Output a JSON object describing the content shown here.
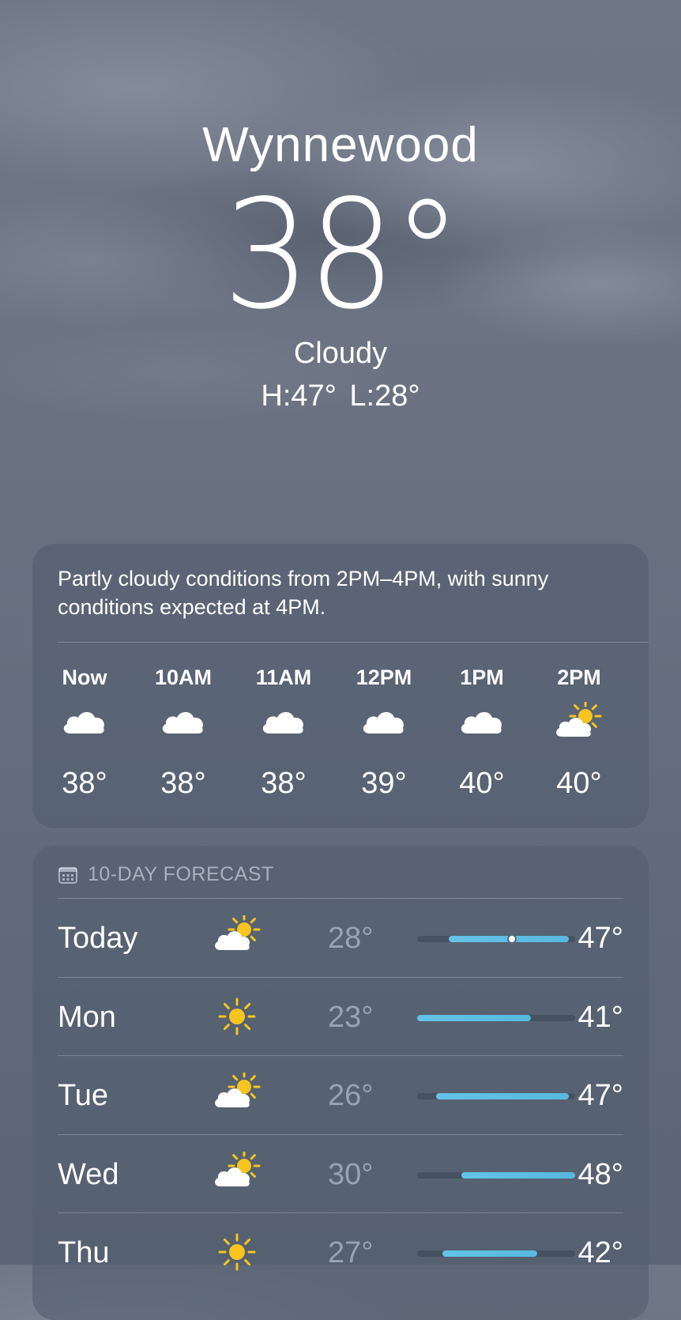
{
  "location": {
    "city": "Wynnewood",
    "temperature": "38°",
    "condition": "Cloudy",
    "high_low": "H:47°  L:28°"
  },
  "hourly": {
    "summary": "Partly cloudy conditions from 2PM–4PM, with sunny conditions expected at 4PM.",
    "hours": [
      {
        "time": "Now",
        "icon": "cloud-icon",
        "temp": "38°"
      },
      {
        "time": "10AM",
        "icon": "cloud-icon",
        "temp": "38°"
      },
      {
        "time": "11AM",
        "icon": "cloud-icon",
        "temp": "38°"
      },
      {
        "time": "12PM",
        "icon": "cloud-icon",
        "temp": "39°"
      },
      {
        "time": "1PM",
        "icon": "cloud-icon",
        "temp": "40°"
      },
      {
        "time": "2PM",
        "icon": "partly-sunny-icon",
        "temp": "40°"
      }
    ]
  },
  "forecast": {
    "title": "10-DAY FORECAST",
    "days": [
      {
        "day": "Today",
        "icon": "partly-sunny-icon",
        "low": "28°",
        "high": "47°",
        "current_marker": true
      },
      {
        "day": "Mon",
        "icon": "sun-icon",
        "low": "23°",
        "high": "41°",
        "current_marker": false
      },
      {
        "day": "Tue",
        "icon": "partly-sunny-icon",
        "low": "26°",
        "high": "47°",
        "current_marker": false
      },
      {
        "day": "Wed",
        "icon": "partly-sunny-icon",
        "low": "30°",
        "high": "48°",
        "current_marker": false
      },
      {
        "day": "Thu",
        "icon": "sun-icon",
        "low": "27°",
        "high": "42°",
        "current_marker": false
      }
    ],
    "range": {
      "min": 23,
      "max": 48
    },
    "current_temp": 38
  },
  "colors": {
    "range_bar": "#5fbfe4",
    "sun": "#f7c51e"
  }
}
